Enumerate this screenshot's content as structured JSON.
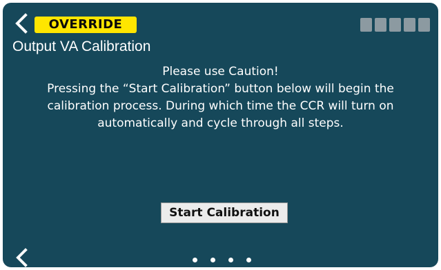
{
  "header": {
    "mode_badge": "OVERRIDE",
    "title": "Output VA Calibration",
    "signal_bars": 5,
    "back_icon": "chevron-left-icon"
  },
  "message": {
    "heading": "Please use Caution!",
    "body": "Pressing the “Start Calibration” button below will begin the calibration process. During which time the CCR will turn on automatically and cycle through all steps."
  },
  "actions": {
    "start_label": "Start Calibration"
  },
  "footer": {
    "back_icon": "chevron-left-icon",
    "page_count": 4
  },
  "colors": {
    "background": "#16485a",
    "badge": "#ffe600",
    "signal_bar": "#8c9aa1",
    "button": "#ececec"
  }
}
